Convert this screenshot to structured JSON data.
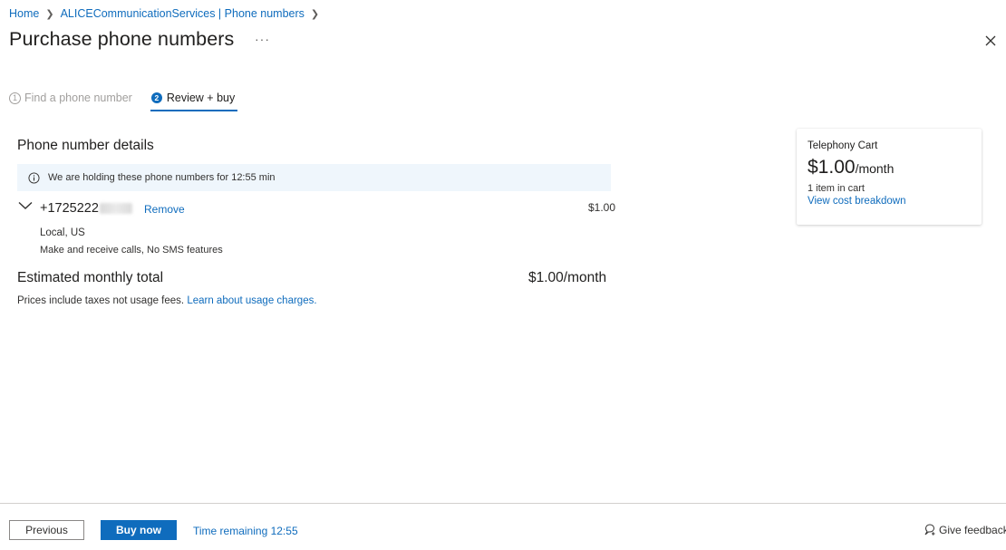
{
  "breadcrumb": {
    "items": [
      "Home",
      "ALICECommunicationServices | Phone numbers"
    ]
  },
  "header": {
    "title": "Purchase phone numbers",
    "more": "···"
  },
  "steps": [
    {
      "number": "1",
      "label": "Find a phone number",
      "state": "completed-inactive"
    },
    {
      "number": "2",
      "label": "Review + buy",
      "state": "active"
    }
  ],
  "details": {
    "title": "Phone number details",
    "holding_notice": "We are holding these phone numbers for 12:55 min",
    "phone_number_visible": "+1725222",
    "remove_label": "Remove",
    "price": "$1.00",
    "location": "Local, US",
    "features": "Make and receive calls, No SMS features"
  },
  "total": {
    "label": "Estimated monthly total",
    "value": "$1.00/month",
    "note": "Prices include taxes not usage fees.",
    "note_link": "Learn about usage charges."
  },
  "cart": {
    "title": "Telephony Cart",
    "price": "$1.00",
    "period": "/month",
    "count": "1 item in cart",
    "breakdown_link": "View cost breakdown"
  },
  "footer": {
    "previous_label": "Previous",
    "buy_label": "Buy now",
    "time_remaining": "Time remaining 12:55",
    "feedback_label": "Give feedback"
  },
  "colors": {
    "accent": "#0f6cbd",
    "info_bg": "#eff6fc",
    "text": "#323130"
  }
}
